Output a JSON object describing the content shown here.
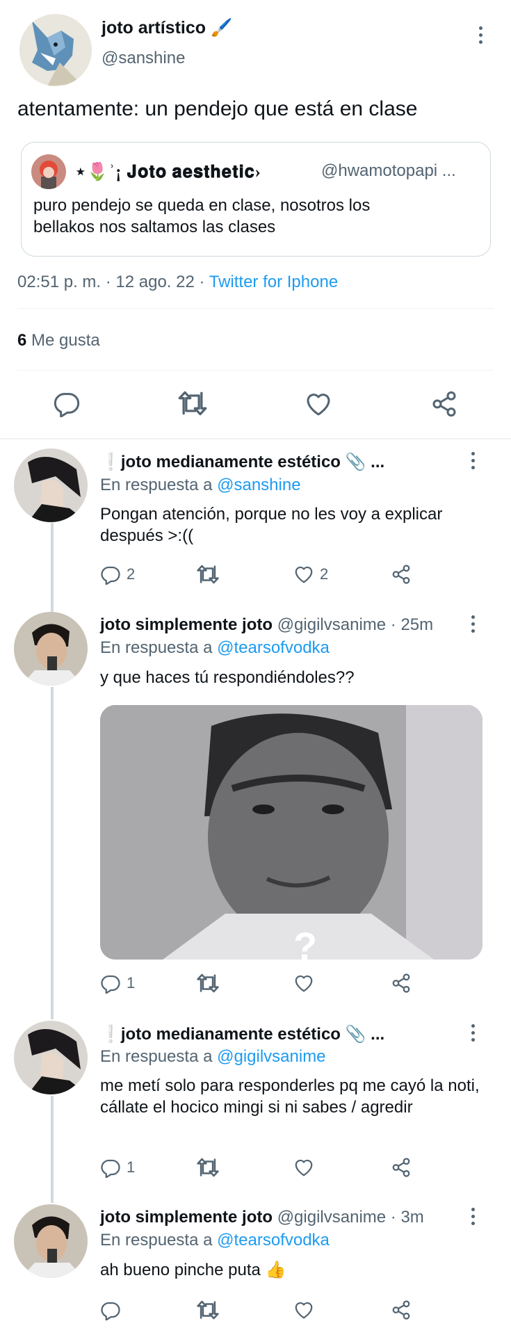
{
  "main_tweet": {
    "author_name": "joto artístico 🖌️",
    "author_handle": "@sanshine",
    "text": "atentamente: un pendejo que está en clase",
    "quote": {
      "author_name": "⋆🌷ʾ¡ 𝐉𝐨𝐭𝐨 𝐚𝐞𝐬𝐭𝐡𝐞𝐭𝐢𝐜›",
      "author_handle": "@hwamotopapi ...",
      "text": "puro pendejo se queda en clase, nosotros los bellakos nos saltamos las clases"
    },
    "timestamp": "02:51 p. m. · 12 ago. 22 · ",
    "source": "Twitter for Iphone",
    "likes_count": "6",
    "likes_label": "Me gusta"
  },
  "replies": [
    {
      "author_name": "❕joto medianamente estético 📎 ...",
      "reply_prefix": "En respuesta a ",
      "reply_to": "@sanshine",
      "text": "Pongan atención, porque no les voy a explicar después >:((",
      "reply_count": "2",
      "retweet_count": "",
      "like_count": "2"
    },
    {
      "author_name": "joto simplemente joto",
      "author_meta": "@gigilvsanime · 25m",
      "reply_prefix": "En respuesta a ",
      "reply_to": "@tearsofvodka",
      "text": "y que haces tú respondiéndoles??",
      "image_overlay": "?",
      "reply_count": "1",
      "retweet_count": "",
      "like_count": ""
    },
    {
      "author_name": "❕joto medianamente estético 📎 ...",
      "reply_prefix": "En respuesta a ",
      "reply_to": "@gigilvsanime",
      "text": "me metí solo para responderles pq me cayó la noti, cállate el hocico mingi si ni sabes / agredir",
      "reply_count": "1",
      "retweet_count": "",
      "like_count": ""
    },
    {
      "author_name": "joto simplemente joto",
      "author_meta": "@gigilvsanime · 3m",
      "reply_prefix": "En respuesta a ",
      "reply_to": "@tearsofvodka",
      "text": "ah bueno pinche puta 👍",
      "reply_count": "",
      "retweet_count": "",
      "like_count": ""
    }
  ],
  "colors": {
    "link": "#1d9bf0",
    "muted": "#536471",
    "divider": "#eff3f4"
  },
  "icons": [
    "reply-icon",
    "retweet-icon",
    "like-icon",
    "share-icon",
    "more-icon"
  ]
}
